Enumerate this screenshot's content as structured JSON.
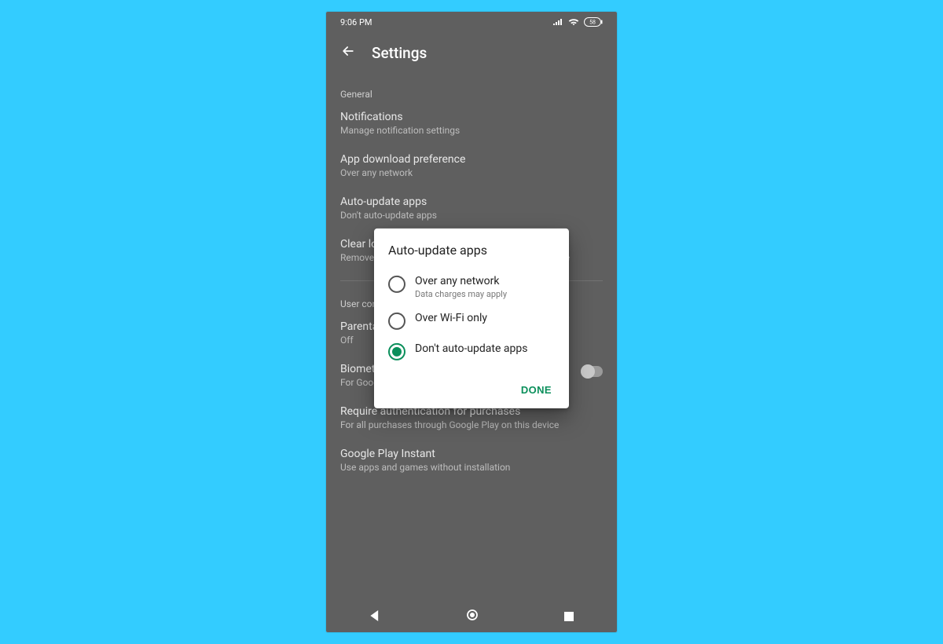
{
  "statusbar": {
    "time": "9:06 PM",
    "battery_pct": "58"
  },
  "appbar": {
    "title": "Settings"
  },
  "sections": {
    "general": {
      "label": "General",
      "notifications": {
        "title": "Notifications",
        "subtitle": "Manage notification settings"
      },
      "download_pref": {
        "title": "App download preference",
        "subtitle": "Over any network"
      },
      "auto_update": {
        "title": "Auto-update apps",
        "subtitle": "Don't auto-update apps"
      },
      "clear_history": {
        "title": "Clear local search history",
        "subtitle": "Remove searches you have performed from this device"
      }
    },
    "user": {
      "label": "User controls",
      "parental": {
        "title": "Parental controls",
        "subtitle": "Off"
      },
      "biometric": {
        "title": "Biometric authentication",
        "subtitle": "For Google Play purchases on this device"
      },
      "require_auth": {
        "title": "Require authentication for purchases",
        "subtitle": "For all purchases through Google Play on this device"
      },
      "instant": {
        "title": "Google Play Instant",
        "subtitle": "Use apps and games without installation"
      }
    }
  },
  "dialog": {
    "title": "Auto-update apps",
    "options": [
      {
        "label": "Over any network",
        "desc": "Data charges may apply",
        "selected": false
      },
      {
        "label": "Over Wi-Fi only",
        "desc": "",
        "selected": false
      },
      {
        "label": "Don't auto-update apps",
        "desc": "",
        "selected": true
      }
    ],
    "done_label": "DONE"
  }
}
